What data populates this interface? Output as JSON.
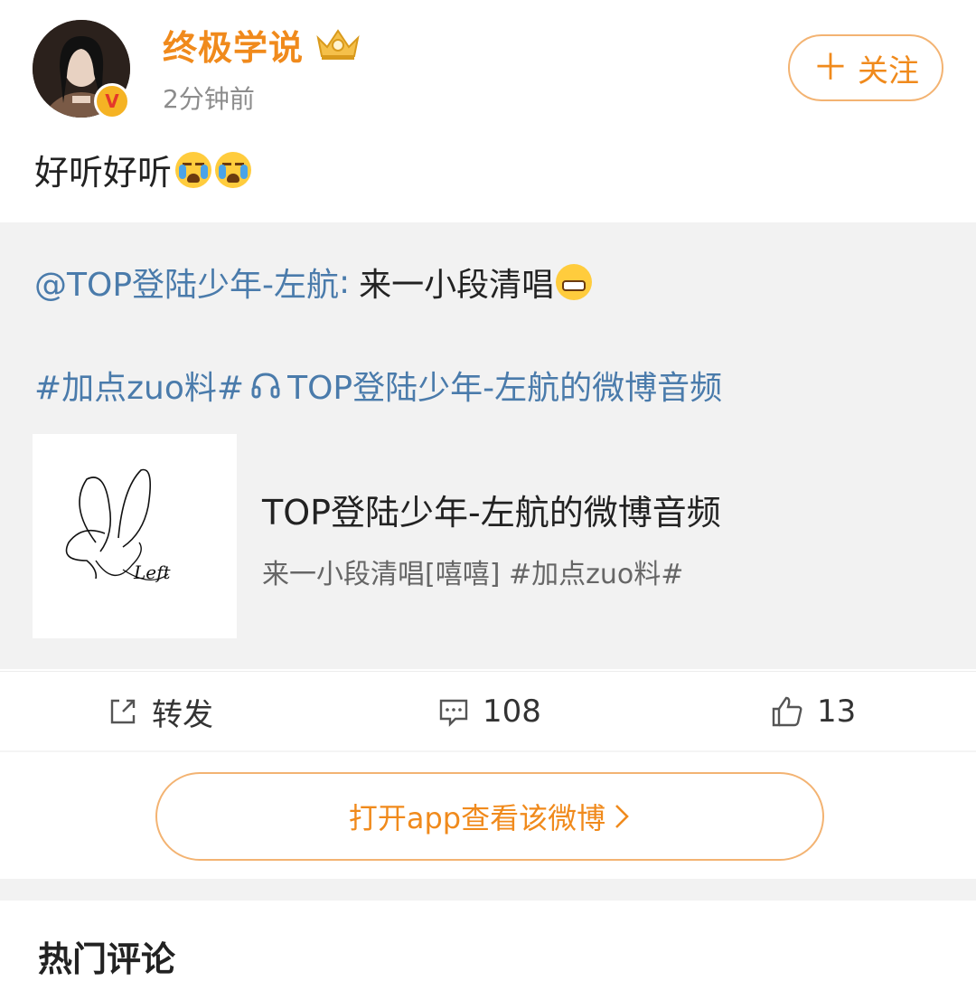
{
  "header": {
    "username": "终极学说",
    "time": "2分钟前",
    "verified_badge": "V",
    "follow_label": "关注",
    "colors": {
      "accent": "#f08a1c",
      "link": "#4a7bab"
    }
  },
  "post": {
    "text": "好听好听",
    "emojis": [
      "crying-emoji",
      "crying-emoji"
    ]
  },
  "repost": {
    "mention": "@TOP登陆少年-左航",
    "colon": ":",
    "text": "来一小段清唱",
    "emoji": "grin-emoji",
    "hashtag": "#加点zuo料#",
    "audio_link": "TOP登陆少年-左航的微博音频",
    "card": {
      "title": "TOP登陆少年-左航的微博音频",
      "desc": "来一小段清唱[嘻嘻] #加点zuo料#",
      "signature": "Left"
    }
  },
  "actions": {
    "repost_label": "转发",
    "comment_count": "108",
    "like_count": "13"
  },
  "open_app": {
    "label": "打开app查看该微博"
  },
  "comments": {
    "title": "热门评论"
  }
}
